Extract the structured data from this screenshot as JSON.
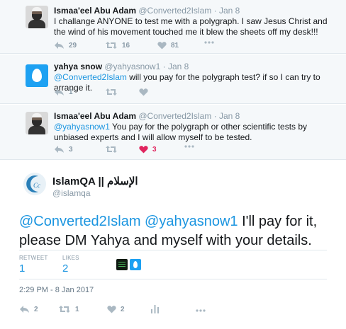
{
  "replies": [
    {
      "name": "Ismaa'eel Abu Adam",
      "handle": "@Converted2Islam",
      "time": "Jan 8",
      "text": "I challange ANYONE to test me with a polygraph. I saw Jesus Christ and the wind of his movement touched me it blew the sheets off my desk!!!",
      "replies": "29",
      "retweets": "16",
      "likes": "81"
    },
    {
      "name": "yahya snow",
      "handle": "@yahyasnow1",
      "time": "Jan 8",
      "mention": "@Converted2Islam",
      "text": " will you pay for the polygraph test? if so I can try to arrange it.",
      "replies": "1"
    },
    {
      "name": "Ismaa'eel Abu Adam",
      "handle": "@Converted2Islam",
      "time": "Jan 8",
      "mention": "@yahyasnow1",
      "text": " You pay for the polygraph or other scientific tests by unbiased experts and I will allow myself to be tested.",
      "replies": "3",
      "likes": "3"
    }
  ],
  "main": {
    "name": "IslamQA || الإسلام",
    "handle": "@islamqa",
    "mention1": "@Converted2Islam",
    "mention2": "@yahyasnow1",
    "text": " I'll pay for it, please DM Yahya and myself with your details.",
    "retweets_label": "RETWEET",
    "retweets": "1",
    "likes_label": "LIKES",
    "likes": "2",
    "timestamp": "2:29 PM - 8 Jan 2017",
    "replies": "2",
    "retweet_count": "1",
    "like_count": "2"
  },
  "ui": {
    "dot_sep": "·",
    "colors": {
      "link": "#1b95e0",
      "like": "#e0245e",
      "muted": "#8899a6",
      "reply_bg": "#f5f8fa"
    }
  }
}
